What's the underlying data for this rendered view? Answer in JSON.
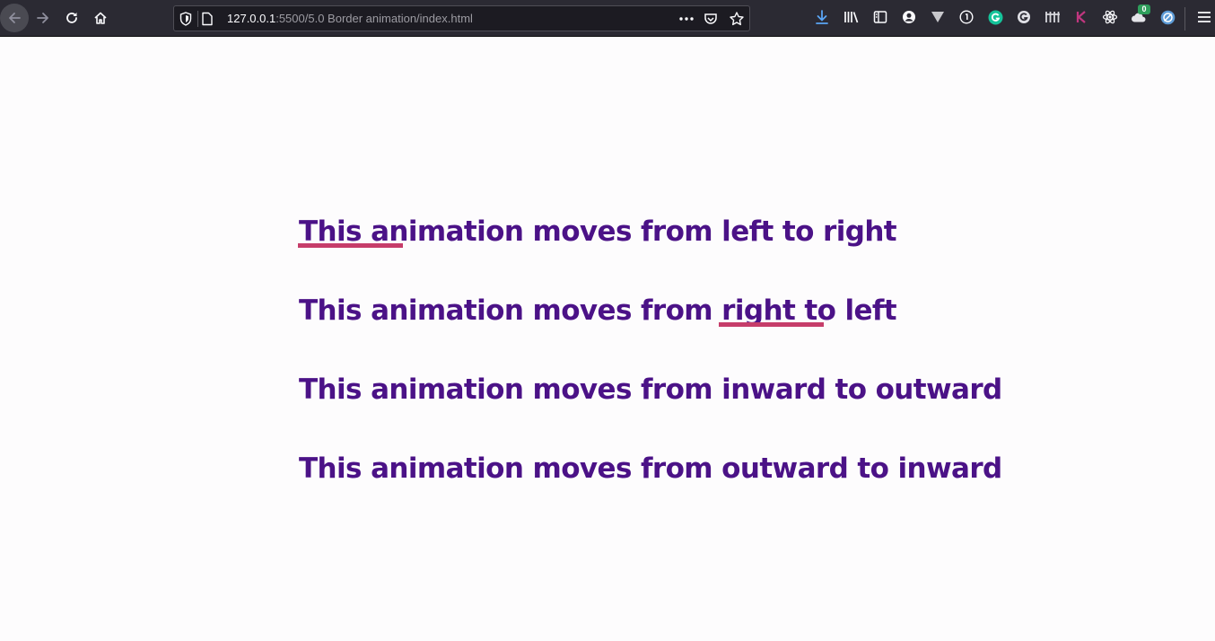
{
  "browser": {
    "url_host": "127.0.0.1",
    "url_rest": ":5500/5.0 Border animation/index.html",
    "extension_badge": "0"
  },
  "page": {
    "lines": [
      "This animation moves from left to right",
      "This animation moves from right to left",
      "This animation moves from inward to outward",
      "This animation moves from outward to inward"
    ],
    "text_color": "#4b1287",
    "underline_color": "#c63d6a"
  },
  "icons": [
    "back-icon",
    "forward-icon",
    "reload-icon",
    "home-icon",
    "shield-icon",
    "page-icon",
    "more-dots-icon",
    "pocket-icon",
    "bookmark-star-icon",
    "download-icon",
    "library-icon",
    "sidebar-icon",
    "account-icon",
    "vivaldi-icon",
    "onepassword-icon",
    "grammarly-icon",
    "gravatar-icon",
    "bars-icon",
    "k-icon",
    "react-icon",
    "cloud-icon",
    "globe-icon",
    "hamburger-menu-icon"
  ]
}
